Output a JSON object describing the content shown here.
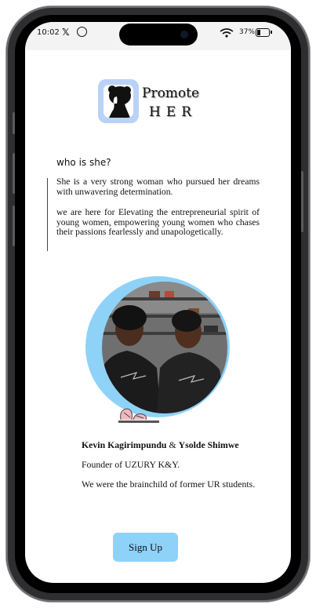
{
  "status_bar": {
    "time": "10:02",
    "battery_percent": "37%",
    "battery_level": 0.37,
    "icons": [
      "x-icon",
      "whatsapp-icon",
      "wifi-icon",
      "battery-icon"
    ]
  },
  "logo": {
    "line1": "Promote",
    "line2": "HER",
    "icon": "woman-silhouette-icon"
  },
  "about": {
    "heading": "who is she?",
    "paragraph1": "She is a very strong woman who  pursued her dreams with unwavering determination.",
    "paragraph2": "we are here for Elevating the entrepreneurial spirit of young women, empowering young women who chases their passions fearlessly and unapologetically."
  },
  "founders": {
    "name1": "Kevin Kagirimpundu",
    "conjunction": "&",
    "name2": "Ysolde Shimwe",
    "title": "Founder of UZURY K&Y.",
    "note": "We were the brainchild of  former UR students."
  },
  "signup": {
    "label": "Sign Up"
  },
  "colors": {
    "accent": "#8fd2f8",
    "logo_bg": "#b9d2f7",
    "text": "#111111"
  }
}
